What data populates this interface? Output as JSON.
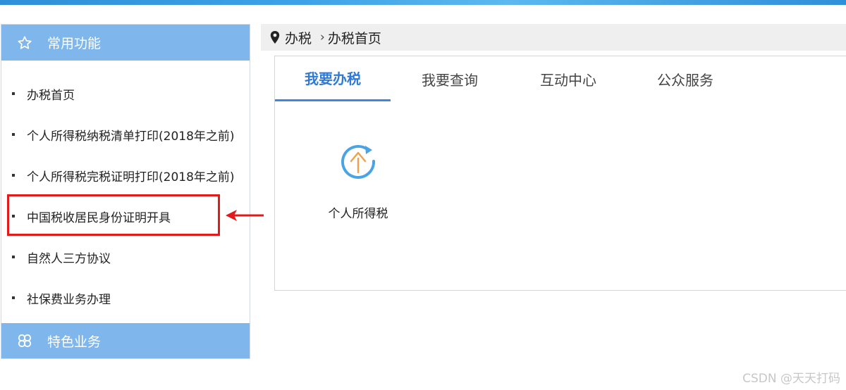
{
  "sidebar": {
    "header_title": "常用功能",
    "items": [
      {
        "label": "办税首页"
      },
      {
        "label": "个人所得税纳税清单打印(2018年之前)"
      },
      {
        "label": "个人所得税完税证明打印(2018年之前)"
      },
      {
        "label": "中国税收居民身份证明开具"
      },
      {
        "label": "自然人三方协议"
      },
      {
        "label": "社保费业务办理"
      }
    ],
    "footer_title": "特色业务"
  },
  "breadcrumb": {
    "root": "办税",
    "separator": "›",
    "current": "办税首页"
  },
  "tabs": [
    {
      "label": "我要办税",
      "active": true
    },
    {
      "label": "我要查询",
      "active": false
    },
    {
      "label": "互动中心",
      "active": false
    },
    {
      "label": "公众服务",
      "active": false
    }
  ],
  "services": [
    {
      "label": "个人所得税",
      "icon": "individual-tax-icon",
      "glyph": "个"
    }
  ],
  "annotation": {
    "highlighted_item": "中国税收居民身份证明开具",
    "color": "#e21a1a"
  },
  "watermark": "CSDN @天天打码",
  "colors": {
    "accent": "#2f7ad8",
    "sidebar_header": "#7fb6ec",
    "breadcrumb_bg": "#efefef"
  }
}
